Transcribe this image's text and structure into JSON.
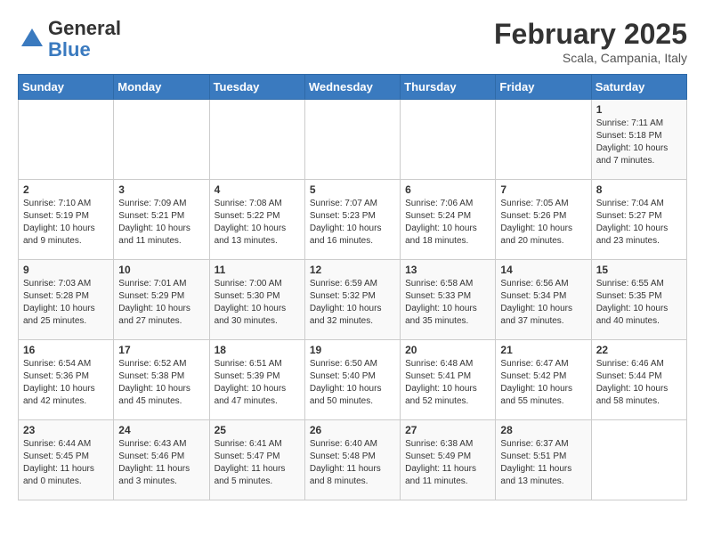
{
  "header": {
    "logo_general": "General",
    "logo_blue": "Blue",
    "month_title": "February 2025",
    "subtitle": "Scala, Campania, Italy"
  },
  "days_of_week": [
    "Sunday",
    "Monday",
    "Tuesday",
    "Wednesday",
    "Thursday",
    "Friday",
    "Saturday"
  ],
  "weeks": [
    [
      {
        "day": "",
        "info": ""
      },
      {
        "day": "",
        "info": ""
      },
      {
        "day": "",
        "info": ""
      },
      {
        "day": "",
        "info": ""
      },
      {
        "day": "",
        "info": ""
      },
      {
        "day": "",
        "info": ""
      },
      {
        "day": "1",
        "info": "Sunrise: 7:11 AM\nSunset: 5:18 PM\nDaylight: 10 hours and 7 minutes."
      }
    ],
    [
      {
        "day": "2",
        "info": "Sunrise: 7:10 AM\nSunset: 5:19 PM\nDaylight: 10 hours and 9 minutes."
      },
      {
        "day": "3",
        "info": "Sunrise: 7:09 AM\nSunset: 5:21 PM\nDaylight: 10 hours and 11 minutes."
      },
      {
        "day": "4",
        "info": "Sunrise: 7:08 AM\nSunset: 5:22 PM\nDaylight: 10 hours and 13 minutes."
      },
      {
        "day": "5",
        "info": "Sunrise: 7:07 AM\nSunset: 5:23 PM\nDaylight: 10 hours and 16 minutes."
      },
      {
        "day": "6",
        "info": "Sunrise: 7:06 AM\nSunset: 5:24 PM\nDaylight: 10 hours and 18 minutes."
      },
      {
        "day": "7",
        "info": "Sunrise: 7:05 AM\nSunset: 5:26 PM\nDaylight: 10 hours and 20 minutes."
      },
      {
        "day": "8",
        "info": "Sunrise: 7:04 AM\nSunset: 5:27 PM\nDaylight: 10 hours and 23 minutes."
      }
    ],
    [
      {
        "day": "9",
        "info": "Sunrise: 7:03 AM\nSunset: 5:28 PM\nDaylight: 10 hours and 25 minutes."
      },
      {
        "day": "10",
        "info": "Sunrise: 7:01 AM\nSunset: 5:29 PM\nDaylight: 10 hours and 27 minutes."
      },
      {
        "day": "11",
        "info": "Sunrise: 7:00 AM\nSunset: 5:30 PM\nDaylight: 10 hours and 30 minutes."
      },
      {
        "day": "12",
        "info": "Sunrise: 6:59 AM\nSunset: 5:32 PM\nDaylight: 10 hours and 32 minutes."
      },
      {
        "day": "13",
        "info": "Sunrise: 6:58 AM\nSunset: 5:33 PM\nDaylight: 10 hours and 35 minutes."
      },
      {
        "day": "14",
        "info": "Sunrise: 6:56 AM\nSunset: 5:34 PM\nDaylight: 10 hours and 37 minutes."
      },
      {
        "day": "15",
        "info": "Sunrise: 6:55 AM\nSunset: 5:35 PM\nDaylight: 10 hours and 40 minutes."
      }
    ],
    [
      {
        "day": "16",
        "info": "Sunrise: 6:54 AM\nSunset: 5:36 PM\nDaylight: 10 hours and 42 minutes."
      },
      {
        "day": "17",
        "info": "Sunrise: 6:52 AM\nSunset: 5:38 PM\nDaylight: 10 hours and 45 minutes."
      },
      {
        "day": "18",
        "info": "Sunrise: 6:51 AM\nSunset: 5:39 PM\nDaylight: 10 hours and 47 minutes."
      },
      {
        "day": "19",
        "info": "Sunrise: 6:50 AM\nSunset: 5:40 PM\nDaylight: 10 hours and 50 minutes."
      },
      {
        "day": "20",
        "info": "Sunrise: 6:48 AM\nSunset: 5:41 PM\nDaylight: 10 hours and 52 minutes."
      },
      {
        "day": "21",
        "info": "Sunrise: 6:47 AM\nSunset: 5:42 PM\nDaylight: 10 hours and 55 minutes."
      },
      {
        "day": "22",
        "info": "Sunrise: 6:46 AM\nSunset: 5:44 PM\nDaylight: 10 hours and 58 minutes."
      }
    ],
    [
      {
        "day": "23",
        "info": "Sunrise: 6:44 AM\nSunset: 5:45 PM\nDaylight: 11 hours and 0 minutes."
      },
      {
        "day": "24",
        "info": "Sunrise: 6:43 AM\nSunset: 5:46 PM\nDaylight: 11 hours and 3 minutes."
      },
      {
        "day": "25",
        "info": "Sunrise: 6:41 AM\nSunset: 5:47 PM\nDaylight: 11 hours and 5 minutes."
      },
      {
        "day": "26",
        "info": "Sunrise: 6:40 AM\nSunset: 5:48 PM\nDaylight: 11 hours and 8 minutes."
      },
      {
        "day": "27",
        "info": "Sunrise: 6:38 AM\nSunset: 5:49 PM\nDaylight: 11 hours and 11 minutes."
      },
      {
        "day": "28",
        "info": "Sunrise: 6:37 AM\nSunset: 5:51 PM\nDaylight: 11 hours and 13 minutes."
      },
      {
        "day": "",
        "info": ""
      }
    ]
  ]
}
